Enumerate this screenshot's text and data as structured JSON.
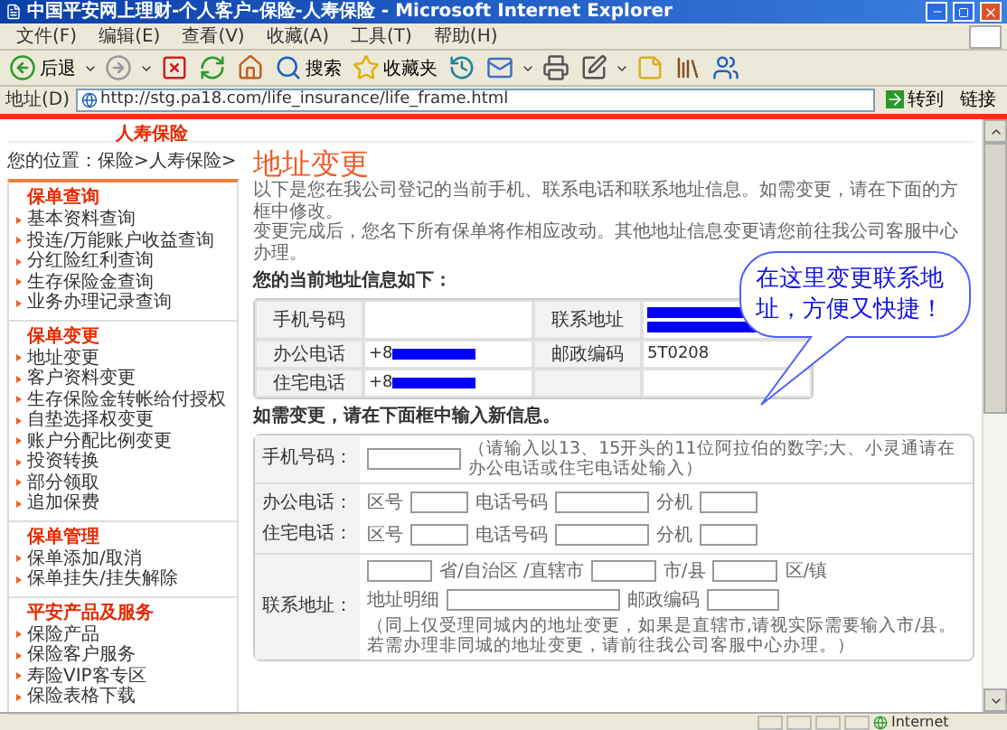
{
  "window": {
    "title": "中国平安网上理财-个人客户-保险-人寿保险 - Microsoft Internet Explorer"
  },
  "menu": [
    "文件(F)",
    "编辑(E)",
    "查看(V)",
    "收藏(A)",
    "工具(T)",
    "帮助(H)"
  ],
  "toolbar": [
    {
      "kind": "back",
      "label": "后退",
      "dropdown": true
    },
    {
      "kind": "forward",
      "dropdown": true
    },
    {
      "kind": "stop"
    },
    {
      "kind": "refresh"
    },
    {
      "kind": "home"
    },
    {
      "kind": "search",
      "label": "搜索"
    },
    {
      "kind": "favorites",
      "label": "收藏夹"
    },
    {
      "kind": "history"
    },
    {
      "kind": "mail",
      "dropdown": true
    },
    {
      "kind": "print"
    },
    {
      "kind": "edit",
      "dropdown": true
    },
    {
      "kind": "notes"
    },
    {
      "kind": "research"
    },
    {
      "kind": "messenger"
    }
  ],
  "address_bar": {
    "label": "地址(D)",
    "url": "http://stg.pa18.com/life_insurance/life_frame.html",
    "go": "转到",
    "links": "链接"
  },
  "site_header": {
    "tab": "人寿保险"
  },
  "breadcrumb": "您的位置：保险>人寿保险>",
  "sidebar": [
    {
      "title": "保单查询",
      "items": [
        "基本资料查询",
        "投连/万能账户收益查询",
        "分红险红利查询",
        "生存保险金查询",
        "业务办理记录查询"
      ]
    },
    {
      "title": "保单变更",
      "items": [
        "地址变更",
        "客户资料变更",
        "生存保险金转帐给付授权",
        "自垫选择权变更",
        "账户分配比例变更",
        "投资转换",
        "部分领取",
        "追加保费"
      ]
    },
    {
      "title": "保单管理",
      "items": [
        "保单添加/取消",
        "保单挂失/挂失解除"
      ]
    },
    {
      "title": "平安产品及服务",
      "items": [
        "保险产品",
        "保险客户服务",
        "寿险VIP客专区",
        "保险表格下载"
      ]
    }
  ],
  "page": {
    "title": "地址变更",
    "intro": [
      "以下是您在我公司登记的当前手机、联系电话和联系地址信息。如需变更，请在下面的方框中修改。",
      "变更完成后，您名下所有保单将作相应改动。其他地址信息变更请您前往我公司客服中心办理。"
    ],
    "current_heading": "您的当前地址信息如下：",
    "current_rows": [
      [
        {
          "label": "手机号码"
        },
        {
          "label": "联系地址",
          "kind": "two_line",
          "redacted": true
        }
      ],
      [
        {
          "label": "办公电话",
          "kind": "one_line",
          "value": "+8",
          "redacted": true
        },
        {
          "label": "邮政编码",
          "kind": "one_line",
          "value": "5T0208"
        }
      ],
      [
        {
          "label": "住宅电话",
          "kind": "one_line",
          "value": "+8",
          "redacted": true
        }
      ]
    ],
    "change_heading": "如需变更，请在下面框中输入新信息。",
    "form": [
      {
        "kind": "mobile",
        "label": "手机号码：",
        "hint": "（请输入以13、15开头的11位阿拉伯的数字;大、小灵通请在办公电话或住宅电话处输入）"
      },
      {
        "kind": "phones",
        "lines": [
          {
            "label": "办公电话：",
            "area": "区号",
            "number": "电话号码",
            "ext": "分机"
          },
          {
            "label": "住宅电话：",
            "area": "区号",
            "number": "电话号码",
            "ext": "分机"
          }
        ]
      },
      {
        "kind": "address",
        "label": "联系地址：",
        "province": "省/自治区 /直辖市",
        "city": "市/县",
        "district": "区/镇",
        "detail": "地址明细",
        "postcode": "邮政编码",
        "note": "（同上仅受理同城内的地址变更，如果是直辖市,请视实际需要输入市/县。若需办理非同城的地址变更，请前往我公司客服中心办理。）"
      }
    ]
  },
  "callout": {
    "text": "在这里变更联系地址，方便又快捷！"
  },
  "status_bar": {
    "zone": "Internet"
  }
}
